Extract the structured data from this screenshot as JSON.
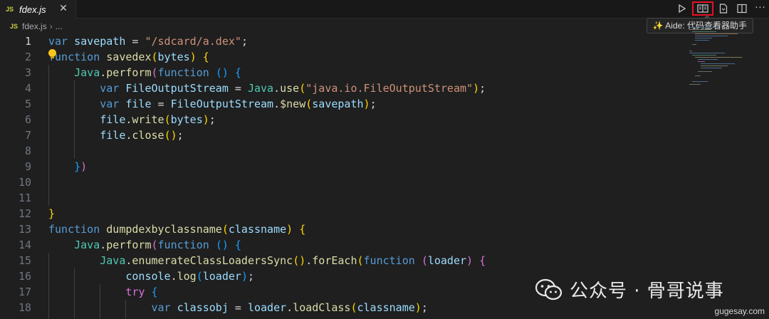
{
  "tab": {
    "badge": "JS",
    "title": "fdex.js",
    "close": "✕"
  },
  "toolbar": {
    "run_icon": "play-icon",
    "aide_icon": "book-reader-icon",
    "file_icon": "file-icon",
    "split_icon": "split-editor-icon",
    "more": "···"
  },
  "tooltip": "✨ Aide: 代码查看器助手",
  "breadcrumb": {
    "badge": "JS",
    "file": "fdex.js",
    "sep": "›",
    "more": "..."
  },
  "code_lines": [
    {
      "n": "1",
      "tokens": [
        {
          "t": "var",
          "c": "kw"
        },
        {
          "t": " savepath ",
          "c": "var"
        },
        {
          "t": "= ",
          "c": "pl"
        },
        {
          "t": "\"/sdcard/a.dex\"",
          "c": "str"
        },
        {
          "t": ";",
          "c": "pl"
        }
      ]
    },
    {
      "n": "2",
      "tokens": [
        {
          "t": "function",
          "c": "kw"
        },
        {
          "t": " ",
          "c": "pl"
        },
        {
          "t": "savedex",
          "c": "fn"
        },
        {
          "t": "(",
          "c": "b1"
        },
        {
          "t": "bytes",
          "c": "var"
        },
        {
          "t": ")",
          "c": "b1"
        },
        {
          "t": " ",
          "c": "pl"
        },
        {
          "t": "{",
          "c": "b1"
        }
      ]
    },
    {
      "n": "3",
      "tokens": [
        {
          "t": "    ",
          "c": "pl"
        },
        {
          "t": "Java",
          "c": "cls"
        },
        {
          "t": ".",
          "c": "pl"
        },
        {
          "t": "perform",
          "c": "fn"
        },
        {
          "t": "(",
          "c": "b2"
        },
        {
          "t": "function",
          "c": "kw"
        },
        {
          "t": " ",
          "c": "pl"
        },
        {
          "t": "()",
          "c": "b3"
        },
        {
          "t": " ",
          "c": "pl"
        },
        {
          "t": "{",
          "c": "b3"
        }
      ]
    },
    {
      "n": "4",
      "tokens": [
        {
          "t": "        ",
          "c": "pl"
        },
        {
          "t": "var",
          "c": "kw"
        },
        {
          "t": " FileOutputStream ",
          "c": "var"
        },
        {
          "t": "= ",
          "c": "pl"
        },
        {
          "t": "Java",
          "c": "cls"
        },
        {
          "t": ".",
          "c": "pl"
        },
        {
          "t": "use",
          "c": "fn"
        },
        {
          "t": "(",
          "c": "b1"
        },
        {
          "t": "\"java.io.FileOutputStream\"",
          "c": "str"
        },
        {
          "t": ")",
          "c": "b1"
        },
        {
          "t": ";",
          "c": "pl"
        }
      ]
    },
    {
      "n": "5",
      "tokens": [
        {
          "t": "        ",
          "c": "pl"
        },
        {
          "t": "var",
          "c": "kw"
        },
        {
          "t": " file ",
          "c": "var"
        },
        {
          "t": "= ",
          "c": "pl"
        },
        {
          "t": "FileOutputStream",
          "c": "var"
        },
        {
          "t": ".",
          "c": "pl"
        },
        {
          "t": "$new",
          "c": "fn"
        },
        {
          "t": "(",
          "c": "b1"
        },
        {
          "t": "savepath",
          "c": "var"
        },
        {
          "t": ")",
          "c": "b1"
        },
        {
          "t": ";",
          "c": "pl"
        }
      ]
    },
    {
      "n": "6",
      "tokens": [
        {
          "t": "        ",
          "c": "pl"
        },
        {
          "t": "file",
          "c": "var"
        },
        {
          "t": ".",
          "c": "pl"
        },
        {
          "t": "write",
          "c": "fn"
        },
        {
          "t": "(",
          "c": "b1"
        },
        {
          "t": "bytes",
          "c": "var"
        },
        {
          "t": ")",
          "c": "b1"
        },
        {
          "t": ";",
          "c": "pl"
        }
      ]
    },
    {
      "n": "7",
      "tokens": [
        {
          "t": "        ",
          "c": "pl"
        },
        {
          "t": "file",
          "c": "var"
        },
        {
          "t": ".",
          "c": "pl"
        },
        {
          "t": "close",
          "c": "fn"
        },
        {
          "t": "()",
          "c": "b1"
        },
        {
          "t": ";",
          "c": "pl"
        }
      ]
    },
    {
      "n": "8",
      "tokens": []
    },
    {
      "n": "9",
      "tokens": [
        {
          "t": "    ",
          "c": "pl"
        },
        {
          "t": "}",
          "c": "b3"
        },
        {
          "t": ")",
          "c": "b2"
        }
      ]
    },
    {
      "n": "10",
      "tokens": []
    },
    {
      "n": "11",
      "tokens": []
    },
    {
      "n": "12",
      "tokens": [
        {
          "t": "}",
          "c": "b1"
        }
      ]
    },
    {
      "n": "13",
      "tokens": [
        {
          "t": "function",
          "c": "kw"
        },
        {
          "t": " ",
          "c": "pl"
        },
        {
          "t": "dumpdexbyclassname",
          "c": "fn"
        },
        {
          "t": "(",
          "c": "b1"
        },
        {
          "t": "classname",
          "c": "var"
        },
        {
          "t": ")",
          "c": "b1"
        },
        {
          "t": " ",
          "c": "pl"
        },
        {
          "t": "{",
          "c": "b1"
        }
      ]
    },
    {
      "n": "14",
      "tokens": [
        {
          "t": "    ",
          "c": "pl"
        },
        {
          "t": "Java",
          "c": "cls"
        },
        {
          "t": ".",
          "c": "pl"
        },
        {
          "t": "perform",
          "c": "fn"
        },
        {
          "t": "(",
          "c": "b2"
        },
        {
          "t": "function",
          "c": "kw"
        },
        {
          "t": " ",
          "c": "pl"
        },
        {
          "t": "()",
          "c": "b3"
        },
        {
          "t": " ",
          "c": "pl"
        },
        {
          "t": "{",
          "c": "b3"
        }
      ]
    },
    {
      "n": "15",
      "tokens": [
        {
          "t": "        ",
          "c": "pl"
        },
        {
          "t": "Java",
          "c": "cls"
        },
        {
          "t": ".",
          "c": "pl"
        },
        {
          "t": "enumerateClassLoadersSync",
          "c": "fn"
        },
        {
          "t": "()",
          "c": "b1"
        },
        {
          "t": ".",
          "c": "pl"
        },
        {
          "t": "forEach",
          "c": "fn"
        },
        {
          "t": "(",
          "c": "b1"
        },
        {
          "t": "function",
          "c": "kw"
        },
        {
          "t": " ",
          "c": "pl"
        },
        {
          "t": "(",
          "c": "b2"
        },
        {
          "t": "loader",
          "c": "var"
        },
        {
          "t": ")",
          "c": "b2"
        },
        {
          "t": " ",
          "c": "pl"
        },
        {
          "t": "{",
          "c": "b2"
        }
      ]
    },
    {
      "n": "16",
      "tokens": [
        {
          "t": "            ",
          "c": "pl"
        },
        {
          "t": "console",
          "c": "var"
        },
        {
          "t": ".",
          "c": "pl"
        },
        {
          "t": "log",
          "c": "fn"
        },
        {
          "t": "(",
          "c": "b3"
        },
        {
          "t": "loader",
          "c": "var"
        },
        {
          "t": ")",
          "c": "b3"
        },
        {
          "t": ";",
          "c": "pl"
        }
      ]
    },
    {
      "n": "17",
      "tokens": [
        {
          "t": "            ",
          "c": "pl"
        },
        {
          "t": "try",
          "c": "b2"
        },
        {
          "t": " ",
          "c": "pl"
        },
        {
          "t": "{",
          "c": "b3"
        }
      ]
    },
    {
      "n": "18",
      "tokens": [
        {
          "t": "                ",
          "c": "pl"
        },
        {
          "t": "var",
          "c": "kw"
        },
        {
          "t": " classobj ",
          "c": "var"
        },
        {
          "t": "= ",
          "c": "pl"
        },
        {
          "t": "loader",
          "c": "var"
        },
        {
          "t": ".",
          "c": "pl"
        },
        {
          "t": "loadClass",
          "c": "fn"
        },
        {
          "t": "(",
          "c": "b1"
        },
        {
          "t": "classname",
          "c": "var"
        },
        {
          "t": ")",
          "c": "b1"
        },
        {
          "t": ";",
          "c": "pl"
        }
      ]
    }
  ],
  "colors": {
    "keyword": "#569cd6",
    "variable": "#9cdcfe",
    "function": "#dcdcaa",
    "string": "#ce9178",
    "class": "#4ec9b0",
    "highlight_border": "#e81123"
  },
  "watermark": {
    "icon": "wechat-icon",
    "text": "公众号 · 骨哥说事",
    "site": "gugesay.com"
  }
}
